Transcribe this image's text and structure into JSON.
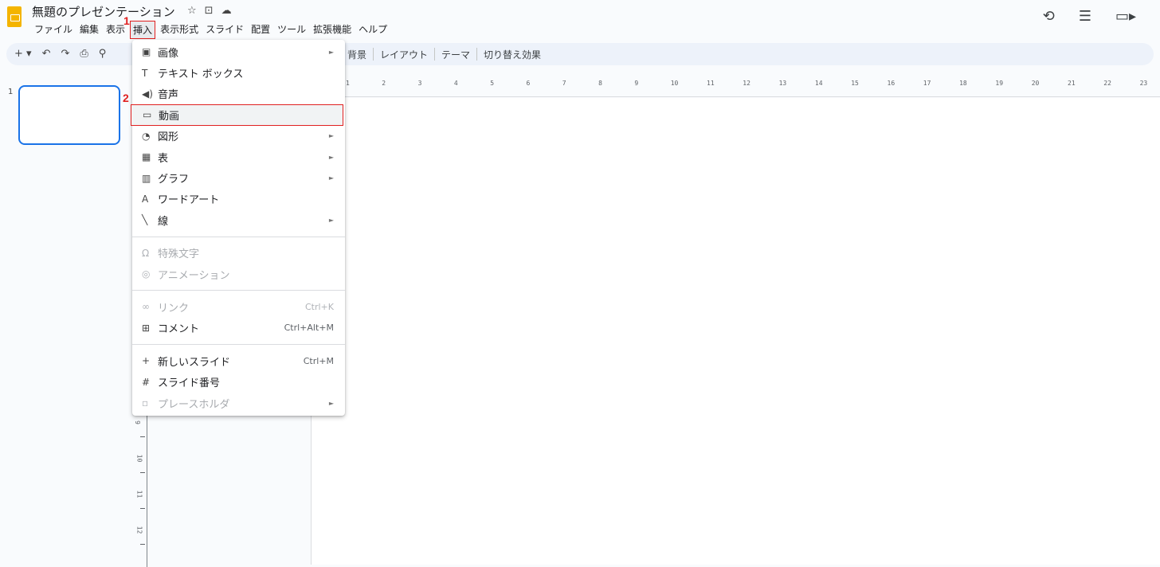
{
  "header": {
    "title": "無題のプレゼンテーション",
    "title_icons": [
      "star-icon",
      "folder-icon",
      "cloud-icon"
    ],
    "menus": [
      "ファイル",
      "編集",
      "表示",
      "挿入",
      "表示形式",
      "スライド",
      "配置",
      "ツール",
      "拡張機能",
      "ヘルプ"
    ],
    "right_icons": [
      "history-icon",
      "comment-icon",
      "video-call-icon"
    ]
  },
  "toolbar": {
    "items": [
      "背景",
      "レイアウト",
      "テーマ",
      "切り替え効果"
    ]
  },
  "annotations": {
    "step1": "1",
    "step2": "2"
  },
  "slides": {
    "current_number": "1"
  },
  "ruler": {
    "h_labels": [
      "1",
      "2",
      "3",
      "4",
      "5",
      "6",
      "7",
      "8",
      "9",
      "10",
      "11",
      "12",
      "13",
      "14",
      "15",
      "16",
      "17",
      "18",
      "19",
      "20",
      "21",
      "22",
      "23"
    ],
    "v_labels": [
      "9",
      "10",
      "11",
      "12"
    ]
  },
  "insert_menu": {
    "items": [
      {
        "label": "画像",
        "icon": "image-icon",
        "submenu": true
      },
      {
        "label": "テキスト ボックス",
        "icon": "text-box-icon"
      },
      {
        "label": "音声",
        "icon": "audio-icon"
      },
      {
        "label": "動画",
        "icon": "video-icon",
        "highlighted": true
      },
      {
        "label": "図形",
        "icon": "shape-icon",
        "submenu": true
      },
      {
        "label": "表",
        "icon": "table-icon",
        "submenu": true
      },
      {
        "label": "グラフ",
        "icon": "chart-icon",
        "submenu": true
      },
      {
        "label": "ワードアート",
        "icon": "word-art-icon"
      },
      {
        "label": "線",
        "icon": "line-icon",
        "submenu": true
      },
      {
        "label": "特殊文字",
        "icon": "omega-icon",
        "disabled": true
      },
      {
        "label": "アニメーション",
        "icon": "animation-icon",
        "disabled": true
      },
      {
        "label": "リンク",
        "icon": "link-icon",
        "shortcut": "Ctrl+K",
        "disabled": true
      },
      {
        "label": "コメント",
        "icon": "add-comment-icon",
        "shortcut": "Ctrl+Alt+M"
      },
      {
        "label": "新しいスライド",
        "icon": "plus-icon",
        "shortcut": "Ctrl+M"
      },
      {
        "label": "スライド番号",
        "icon": "hash-icon"
      },
      {
        "label": "プレースホルダ",
        "icon": "placeholder-icon",
        "submenu": true,
        "disabled": true
      }
    ]
  },
  "colors": {
    "accent_blue": "#1a73e8",
    "annotation_red": "#e02020",
    "logo_yellow": "#f4b400"
  }
}
